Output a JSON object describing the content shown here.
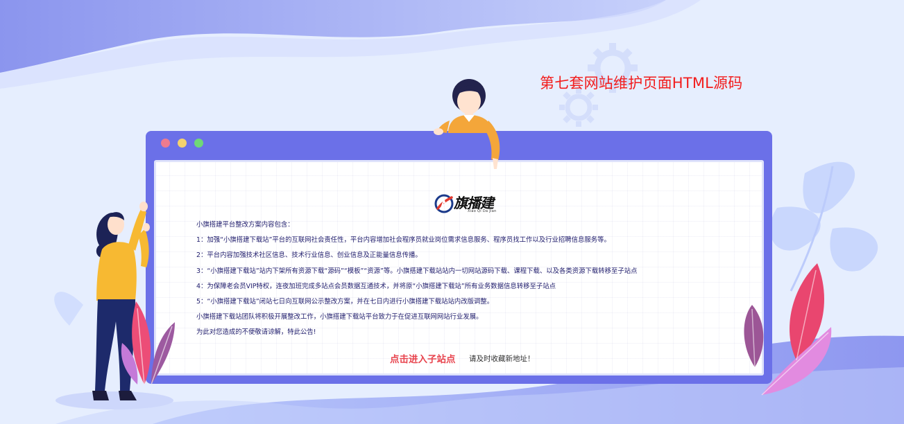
{
  "page": {
    "title": "第七套网站维护页面HTML源码"
  },
  "colors": {
    "background": "#e6eefe",
    "browser_frame": "#6b70e8",
    "title": "#f21c1c",
    "link": "#e8454f",
    "body_text": "#1e1b6b"
  },
  "browser": {
    "controls": [
      "close-dot",
      "minimize-dot",
      "maximize-dot"
    ]
  },
  "logo": {
    "name_cn": "旗播建",
    "name_en": "Xiao Qi Da Jian"
  },
  "notice": {
    "intro": "小旗搭建平台整改方案内容包含：",
    "items": [
      "1：加强“小旗搭建下载站”平台的互联网社会责任性，平台内容增加社会程序员就业岗位需求信息服务、程序员找工作以及行业招聘信息服务等。",
      "2：平台内容加强技术社区信息、技术行业信息、创业信息及正能量信息传播。",
      "3：“小旗搭建下载站”站内下架所有资源下载“源码”“模板”“资源”等。小旗搭建下载站站内一切网站源码下载、课程下载、以及各类资源下载转移至子站点",
      "4：为保障老会员VIP特权，连夜加班完成多站点会员数据互通技术，并将原“小旗搭建下载站”所有业务数据信息转移至子站点",
      "5：“小旗搭建下载站”闭站七日向互联网公示整改方案，并在七日内进行小旗搭建下载站站内改版调整。"
    ],
    "closing": "小旗搭建下载站团队将积极开展整改工作，小旗搭建下载站平台致力于在促进互联网网站行业发展。",
    "apology": "为此对您造成的不便敬请谅解，特此公告!"
  },
  "actions": {
    "enter_link": "点击进入子站点",
    "bookmark_hint": "请及时收藏新地址！"
  }
}
